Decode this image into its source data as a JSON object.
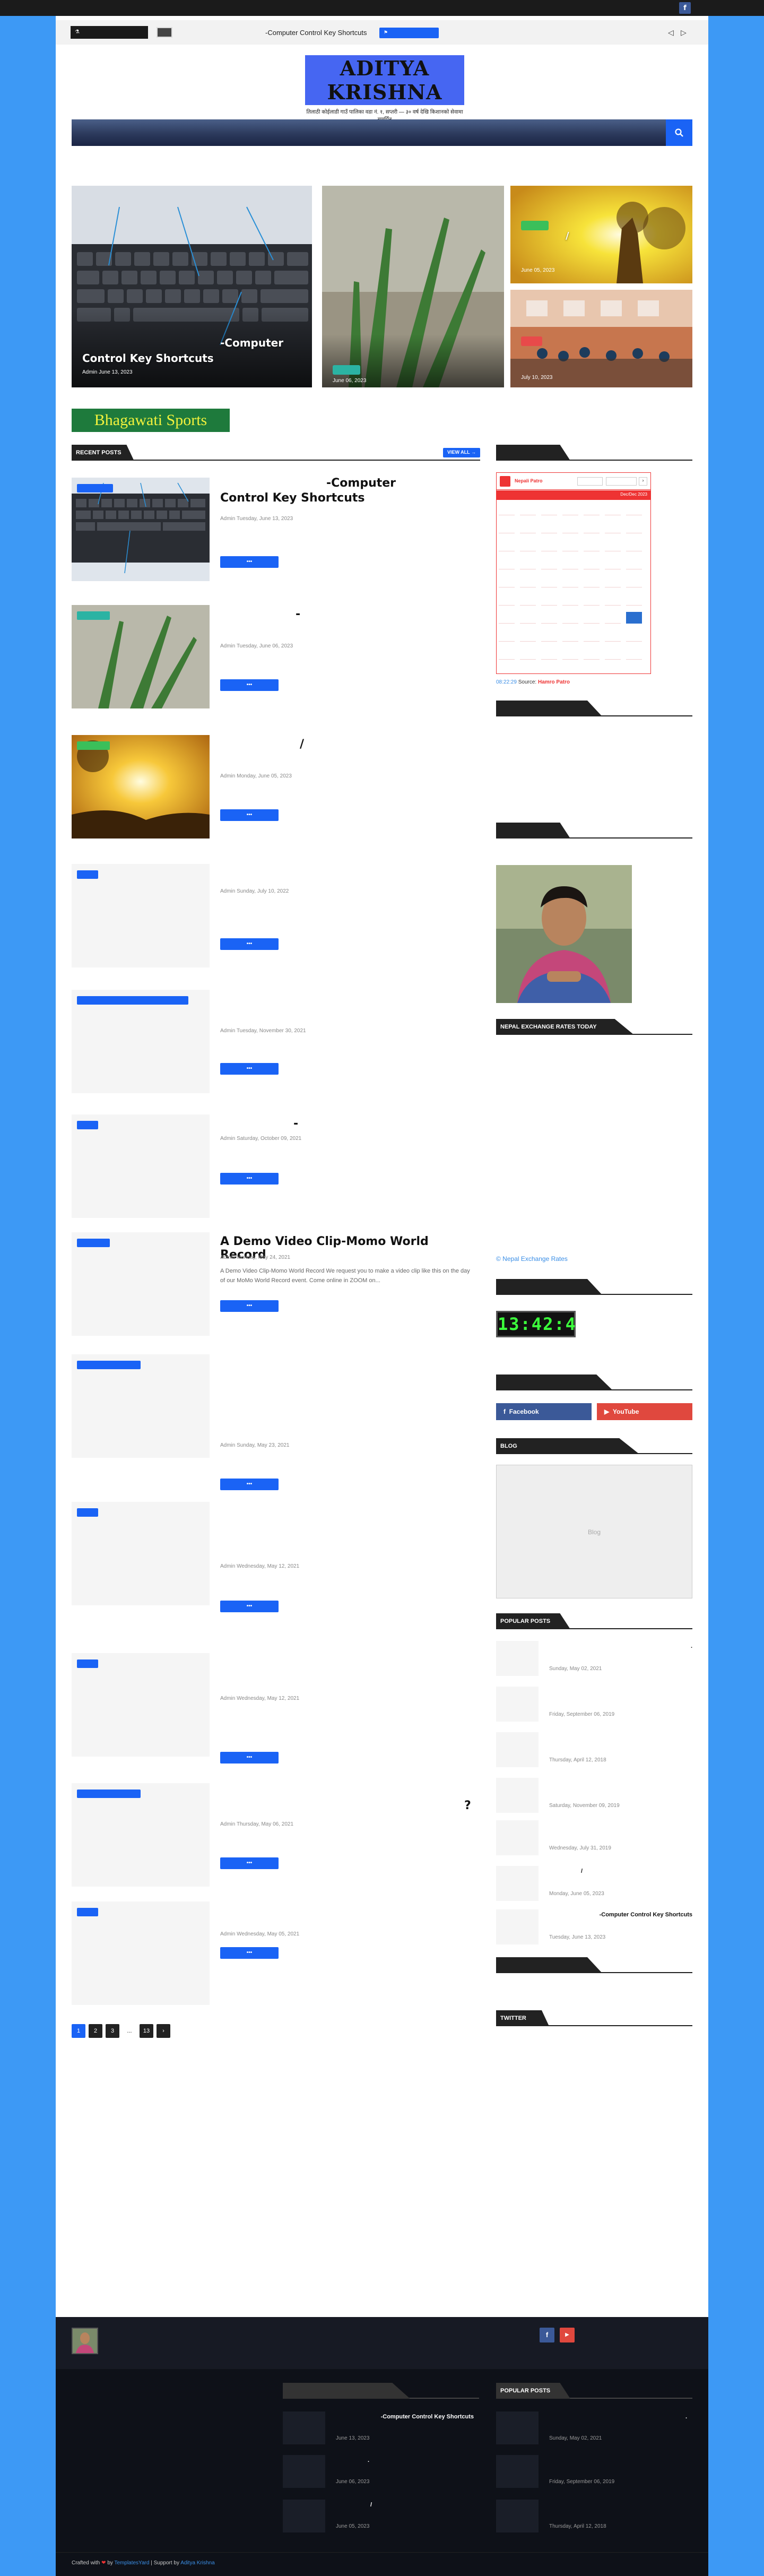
{
  "topbar": {
    "social": "f"
  },
  "ticker": {
    "date": "",
    "headline": "-Computer Control Key Shortcuts",
    "button": "",
    "prev": "◁",
    "next": "▷"
  },
  "logo": {
    "title": "ADITYA KRISHNA",
    "tagline": "तिलाठी कोईलाडी गाउँ पालिका वडा नं. १, सप्तरी — ३० वर्ष देखि किशानको सेवामा समर्पित"
  },
  "nav": {
    "items": [
      "",
      "",
      "",
      "",
      "",
      "",
      ""
    ],
    "search_icon": "search-icon"
  },
  "featured": [
    {
      "title": "-Computer",
      "subtitle": "Control Key Shortcuts",
      "meta": "Admin  June 13, 2023",
      "badge": "",
      "badge_color": "#e0368f"
    },
    {
      "meta": "June 06, 2023",
      "badge": "",
      "badge_color": "#2bb3a3"
    },
    {
      "meta": "June 05, 2023",
      "badge": "",
      "badge_color": "#3bbf5a",
      "title": "/"
    },
    {
      "meta": "July 10, 2023",
      "badge": "",
      "badge_color": "#e84a4a"
    }
  ],
  "ad": {
    "text": "Bhagawati Sports"
  },
  "recent": {
    "heading": "RECENT POSTS",
    "view_all": "VIEW ALL →",
    "posts": [
      {
        "title": "-Computer",
        "title2": "Control Key Shortcuts",
        "meta": "Admin  Tuesday, June 13, 2023",
        "excerpt": "",
        "more": ""
      },
      {
        "title": "-",
        "meta": "Admin  Tuesday, June 06, 2023",
        "excerpt": "",
        "more": ""
      },
      {
        "title": "/",
        "meta": "Admin  Monday, June 05, 2023",
        "excerpt": "",
        "more": ""
      },
      {
        "title": "",
        "meta": "Admin  Sunday, July 10, 2022",
        "excerpt": "",
        "more": ""
      },
      {
        "title": "",
        "meta": "Admin  Tuesday, November 30, 2021",
        "excerpt": "",
        "more": ""
      },
      {
        "title": "-",
        "meta": "Admin  Saturday, October 09, 2021",
        "excerpt": "",
        "more": ""
      },
      {
        "title": "A Demo Video Clip-Momo World Record",
        "meta": "Admin  Monday, May 24, 2021",
        "excerpt": "A Demo Video Clip-Momo World Record We request you to make a video clip like this on the day of our MoMo World Record event. Come online in ZOOM on...",
        "more": ""
      },
      {
        "title": "",
        "meta": "Admin  Sunday, May 23, 2021",
        "excerpt": "",
        "more": ""
      },
      {
        "title": "",
        "meta": "Admin  Wednesday, May 12, 2021",
        "excerpt": "",
        "more": ""
      },
      {
        "title": "",
        "meta": "Admin  Wednesday, May 12, 2021",
        "excerpt": "",
        "more": ""
      },
      {
        "title": "?",
        "meta": "Admin  Thursday, May 06, 2021",
        "excerpt": "",
        "more": ""
      },
      {
        "title": "",
        "meta": "Admin  Wednesday, May 05, 2021",
        "excerpt": "",
        "more": ""
      }
    ]
  },
  "pagination": [
    "1",
    "2",
    "3",
    "...",
    "13",
    "›"
  ],
  "sidebar": {
    "calendar": {
      "title": "Nepali Patro",
      "month_label": "Dec/Dec 2023",
      "footer_time": "08:22:29",
      "footer_label": "Source:",
      "footer_source": "Hamro Patro"
    },
    "nepal_heading": "NEPAL EXCHANGE RATES TODAY",
    "nepal_link": "© Nepal Exchange Rates",
    "clock": "13:42:4",
    "facebook": "Facebook",
    "youtube": "YouTube",
    "blog_heading": "BLOG",
    "blog_text": "Blog",
    "popular_heading": "POPULAR POSTS",
    "popular": [
      {
        "title": ".",
        "date": "Sunday, May 02, 2021"
      },
      {
        "title": "",
        "date": "Friday, September 06, 2019"
      },
      {
        "title": "",
        "date": "Thursday, April 12, 2018"
      },
      {
        "title": "",
        "date": "Saturday, November 09, 2019"
      },
      {
        "title": "",
        "date": "Wednesday, July 31, 2019"
      },
      {
        "title": "/",
        "date": "Monday, June 05, 2023"
      },
      {
        "title": "-Computer Control Key Shortcuts",
        "date": "Tuesday, June 13, 2023"
      }
    ],
    "twitter_heading": "TWITTER"
  },
  "footer": {
    "popular_heading": "POPULAR POSTS",
    "recent": [
      {
        "title": "-Computer Control Key Shortcuts",
        "date": "June 13, 2023"
      },
      {
        "title": ".",
        "date": "June 06, 2023"
      },
      {
        "title": "/",
        "date": "June 05, 2023"
      }
    ],
    "popular": [
      {
        "title": ".",
        "date": "Sunday, May 02, 2021"
      },
      {
        "title": "",
        "date": "Friday, September 06, 2019"
      },
      {
        "title": "",
        "date": "Thursday, April 12, 2018"
      }
    ],
    "copy_prefix": "Crafted with",
    "copy_by": "by",
    "copy_link": "TemplatesYard",
    "copy_support": "| Support by",
    "copy_author": "Aditya Krishna"
  }
}
